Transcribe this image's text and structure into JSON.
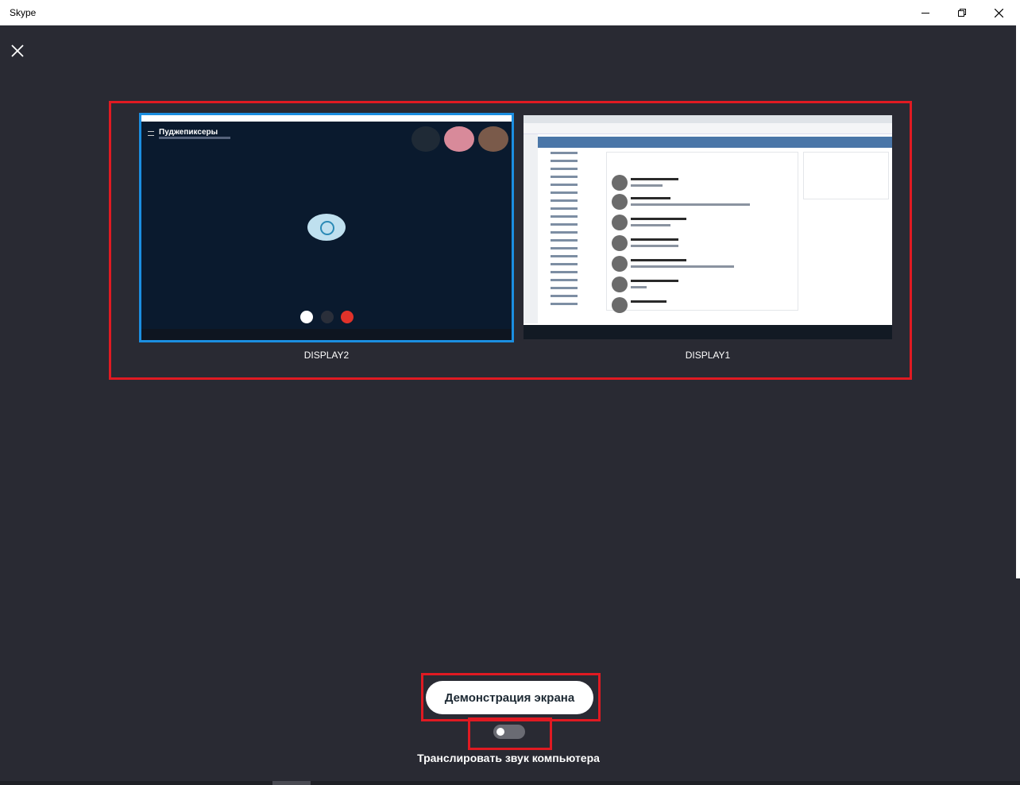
{
  "window": {
    "title": "Skype"
  },
  "screens": [
    {
      "label": "DISPLAY2",
      "selected": true,
      "preview_title": "Пуджепиксеры"
    },
    {
      "label": "DISPLAY1",
      "selected": false
    }
  ],
  "share_button": {
    "label": "Демонстрация экрана"
  },
  "audio_toggle": {
    "label": "Транслировать звук компьютера",
    "enabled": false
  },
  "colors": {
    "background": "#292a33",
    "highlight": "#e01a22",
    "selected_border": "#1b8ee0",
    "end_call": "#e0322a"
  },
  "icons": [
    "minimize-icon",
    "maximize-icon",
    "close-icon",
    "app-close-icon",
    "toggle-switch"
  ]
}
